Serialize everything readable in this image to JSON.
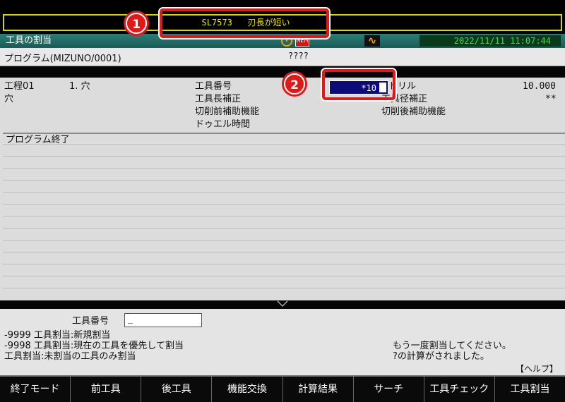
{
  "alarm": {
    "message": "SL7573   刃長が短い"
  },
  "callouts": {
    "one": "1",
    "two": "2"
  },
  "titlebar": {
    "title": "工具の割当",
    "mem_label": "MEM",
    "datetime": "2022/11/11 11:07:44"
  },
  "program": {
    "label": "プログラム(MIZUNO/0001)",
    "value": "????"
  },
  "process": {
    "step_label": "工程01",
    "step_detail": "1. 穴",
    "step_type": "穴",
    "fields": {
      "tool_number_label": "工具番号",
      "tool_number_value": "*10",
      "tool_name_label": "ドリル",
      "tool_name_value": "10.000",
      "length_comp_label": "工具長補正",
      "radius_comp_label": "工具径補正",
      "radius_comp_value": "**",
      "pre_cut_label": "切削前補助機能",
      "post_cut_label": "切削後補助機能",
      "dwell_label": "ドゥエル時間"
    },
    "list_rows": [
      "プログラム終了",
      "",
      "",
      "",
      "",
      "",
      "",
      "",
      "",
      "",
      "",
      "",
      "",
      ""
    ]
  },
  "input": {
    "label": "工具番号",
    "value": "_",
    "help_lines": [
      "-9999 工具割当:新規割当",
      "-9998 工具割当:現在の工具を優先して割当",
      "工具割当:未割当の工具のみ割当"
    ],
    "messages": [
      "もう一度割当してください。",
      "?の計算がされました。"
    ],
    "help_link": "【ヘルプ】"
  },
  "softkeys": [
    "終了モード",
    "前工具",
    "後工具",
    "機能交換",
    "計算結果",
    "サーチ",
    "工具チェック",
    "工具割当"
  ],
  "colors": {
    "alarm_yellow": "#e8e800",
    "title_teal": "#1b5a55",
    "highlight_blue": "#0b0b7a",
    "callout_red": "#e01818",
    "clock_green": "#2fe24a"
  }
}
